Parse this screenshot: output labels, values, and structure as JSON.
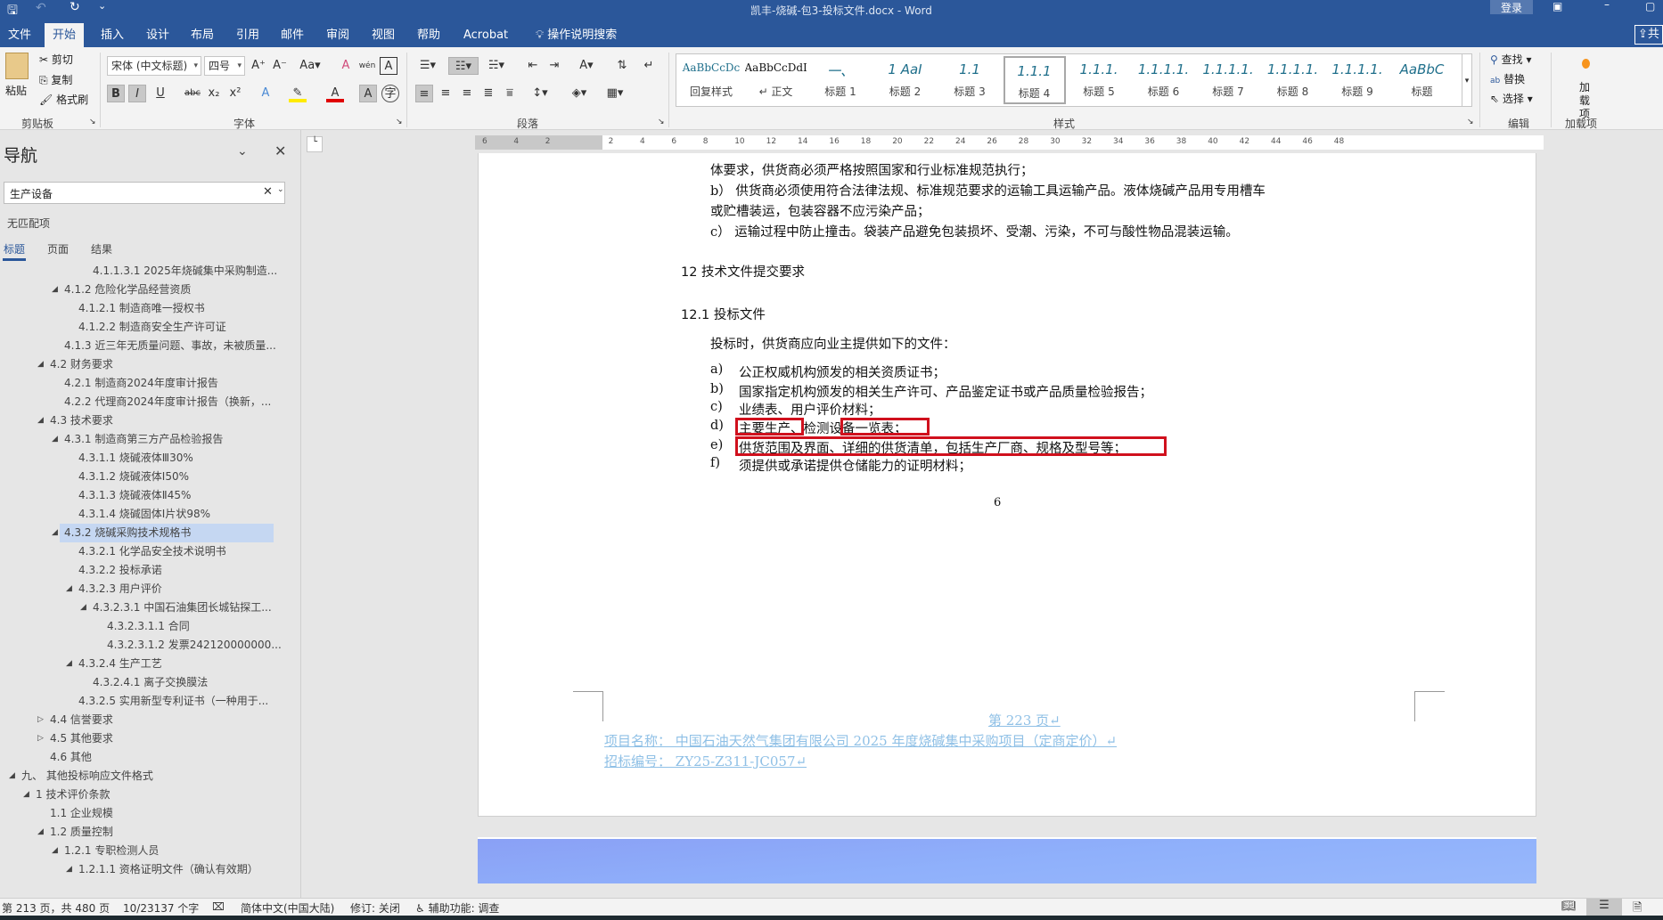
{
  "titlebar": {
    "title": "凯丰-烧碱-包3-投标文件.docx  -  Word",
    "login": "登录",
    "share": "共"
  },
  "tabs": [
    "文件",
    "开始",
    "插入",
    "设计",
    "布局",
    "引用",
    "邮件",
    "审阅",
    "视图",
    "帮助",
    "Acrobat"
  ],
  "tell_me": "操作说明搜索",
  "ribbon": {
    "clipboard": {
      "paste": "粘贴",
      "cut": "剪切",
      "copy": "复制",
      "format_painter": "格式刷",
      "label": "剪贴板"
    },
    "font": {
      "name": "宋体 (中文标题)",
      "size": "四号",
      "label": "字体"
    },
    "paragraph": {
      "label": "段落"
    },
    "styles": {
      "label": "样式",
      "items": [
        {
          "preview": "AaBbCcDc",
          "name": "回复样式"
        },
        {
          "preview": "AaBbCcDdI",
          "name": "↵ 正文"
        },
        {
          "preview": "一、",
          "name": "标题 1"
        },
        {
          "preview": "1 AaI",
          "name": "标题 2"
        },
        {
          "preview": "1.1",
          "name": "标题 3"
        },
        {
          "preview": "1.1.1",
          "name": "标题 4"
        },
        {
          "preview": "1.1.1.",
          "name": "标题 5"
        },
        {
          "preview": "1.1.1.1.",
          "name": "标题 6"
        },
        {
          "preview": "1.1.1.1.",
          "name": "标题 7"
        },
        {
          "preview": "1.1.1.1.",
          "name": "标题 8"
        },
        {
          "preview": "1.1.1.1.",
          "name": "标题 9"
        },
        {
          "preview": "AaBbC",
          "name": "标题"
        }
      ],
      "selected": 5
    },
    "editing": {
      "find": "查找",
      "replace": "替换",
      "select": "选择",
      "label": "编辑"
    },
    "addins": {
      "button": "加载项",
      "label": "加载项"
    }
  },
  "ruler": {
    "ticks": [
      "6",
      "4",
      "2",
      "",
      "2",
      "4",
      "6",
      "8",
      "10",
      "12",
      "14",
      "16",
      "18",
      "20",
      "22",
      "24",
      "26",
      "28",
      "30",
      "32",
      "34",
      "36",
      "38",
      "40",
      "42",
      "44",
      "46",
      "48"
    ]
  },
  "nav": {
    "title": "导航",
    "search_value": "生产设备",
    "no_match": "无匹配项",
    "tabs": [
      "标题",
      "页面",
      "结果"
    ],
    "items": [
      {
        "t": "4.1.1.3.1 2025年烧碱集中采购制造...",
        "l": 5,
        "s": ""
      },
      {
        "t": "4.1.2 危险化学品经营资质",
        "l": 3,
        "s": "e"
      },
      {
        "t": "4.1.2.1 制造商唯一授权书",
        "l": 4,
        "s": ""
      },
      {
        "t": "4.1.2.2 制造商安全生产许可证",
        "l": 4,
        "s": ""
      },
      {
        "t": "4.1.3 近三年无质量问题、事故，未被质量...",
        "l": 3,
        "s": ""
      },
      {
        "t": "4.2 财务要求",
        "l": 2,
        "s": "e"
      },
      {
        "t": "4.2.1 制造商2024年度审计报告",
        "l": 3,
        "s": ""
      },
      {
        "t": "4.2.2 代理商2024年度审计报告（换新，...",
        "l": 3,
        "s": ""
      },
      {
        "t": "4.3 技术要求",
        "l": 2,
        "s": "e"
      },
      {
        "t": "4.3.1 制造商第三方产品检验报告",
        "l": 3,
        "s": "e"
      },
      {
        "t": "4.3.1.1 烧碱液体Ⅲ30%",
        "l": 4,
        "s": ""
      },
      {
        "t": "4.3.1.2 烧碱液体Ⅰ50%",
        "l": 4,
        "s": ""
      },
      {
        "t": "4.3.1.3 烧碱液体Ⅱ45%",
        "l": 4,
        "s": ""
      },
      {
        "t": "4.3.1.4 烧碱固体Ⅰ片状98%",
        "l": 4,
        "s": ""
      },
      {
        "t": "4.3.2 烧碱采购技术规格书",
        "l": 3,
        "s": "e",
        "sel": true
      },
      {
        "t": "4.3.2.1 化学品安全技术说明书",
        "l": 4,
        "s": ""
      },
      {
        "t": "4.3.2.2 投标承诺",
        "l": 4,
        "s": ""
      },
      {
        "t": "4.3.2.3 用户评价",
        "l": 4,
        "s": "e"
      },
      {
        "t": "4.3.2.3.1 中国石油集团长城钻探工...",
        "l": 5,
        "s": "e"
      },
      {
        "t": "4.3.2.3.1.1 合同",
        "l": 6,
        "s": ""
      },
      {
        "t": "4.3.2.3.1.2 发票242120000000...",
        "l": 6,
        "s": ""
      },
      {
        "t": "4.3.2.4 生产工艺",
        "l": 4,
        "s": "e"
      },
      {
        "t": "4.3.2.4.1 离子交换膜法",
        "l": 5,
        "s": ""
      },
      {
        "t": "4.3.2.5 实用新型专利证书（一种用于...",
        "l": 4,
        "s": ""
      },
      {
        "t": "4.4 信誉要求",
        "l": 2,
        "s": "c"
      },
      {
        "t": "4.5 其他要求",
        "l": 2,
        "s": "c"
      },
      {
        "t": "4.6 其他",
        "l": 2,
        "s": ""
      },
      {
        "t": "九、 其他投标响应文件格式",
        "l": 0,
        "s": "e"
      },
      {
        "t": "1 技术评价条款",
        "l": 1,
        "s": "e"
      },
      {
        "t": "1.1 企业规模",
        "l": 2,
        "s": ""
      },
      {
        "t": "1.2 质量控制",
        "l": 2,
        "s": "e"
      },
      {
        "t": "1.2.1 专职检测人员",
        "l": 3,
        "s": "e"
      },
      {
        "t": "1.2.1.1 资格证明文件（确认有效期）",
        "l": 4,
        "s": "e"
      }
    ]
  },
  "document": {
    "lines": [
      "体要求，供货商必须严格按照国家和行业标准规范执行；",
      "b）  供货商必须使用符合法律法规、标准规范要求的运输工具运输产品。液体烧碱产品用专用槽车",
      "或贮槽装运，包装容器不应污染产品；",
      "c）  运输过程中防止撞击。袋装产品避免包装损坏、受潮、污染，不可与酸性物品混装运输。"
    ],
    "heading": "12  技术文件提交要求",
    "subheading": "12.1 投标文件",
    "intro": "投标时，供货商应向业主提供如下的文件：",
    "list": [
      {
        "k": "a)",
        "v": "公正权威机构颁发的相关资质证书；"
      },
      {
        "k": "b)",
        "v": "国家指定机构颁发的相关生产许可、产品鉴定证书或产品质量检验报告；"
      },
      {
        "k": "c)",
        "v": "业绩表、用户评价材料；"
      },
      {
        "k": "d)",
        "v": "主要生产、检测设备一览表；"
      },
      {
        "k": "e)",
        "v": "供货范围及界面、详细的供货清单，包括生产厂商、规格及型号等；"
      },
      {
        "k": "f)",
        "v": "须提供或承诺提供仓储能力的证明材料；"
      }
    ],
    "page_number": "6",
    "footer_page": "第 223 页↵",
    "footer_project": "项目名称：  中国石油天然气集团有限公司 2025 年度烧碱集中采购项目（定商定价）↵",
    "footer_bid": "招标编号：  ZY25-Z311-JC057↵"
  },
  "status": {
    "page": "第 213 页，共 480 页",
    "words": "10/23137 个字",
    "language": "简体中文(中国大陆)",
    "track": "修订: 关闭",
    "accessibility": "辅助功能: 调查"
  },
  "colors": {
    "brand": "#2b579a",
    "highlight_box": "#d0101d",
    "footer_text": "#8fc0e6"
  }
}
